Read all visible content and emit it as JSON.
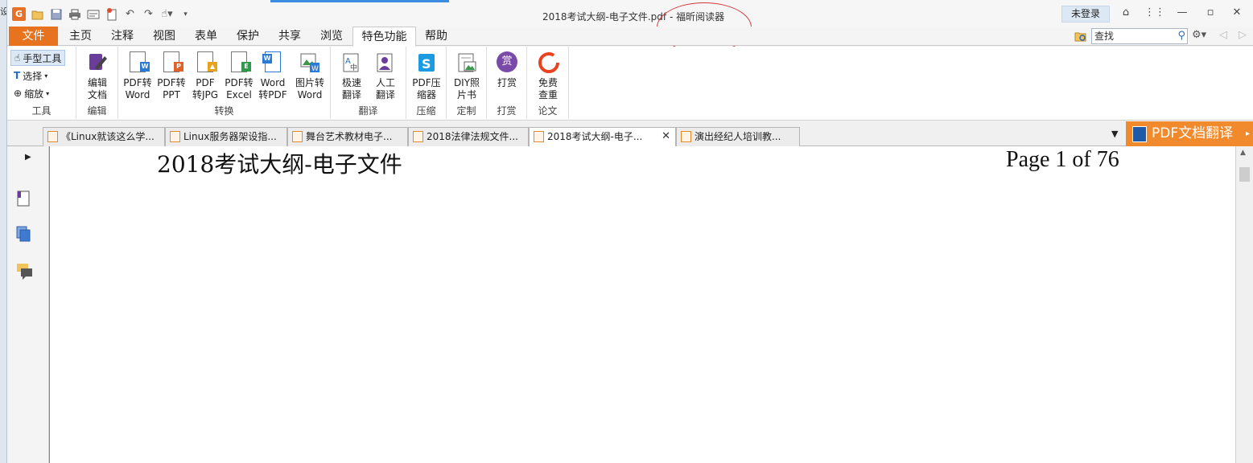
{
  "titlebar": {
    "title_doc": "2018考试大纲-电子文件.pdf - ",
    "title_app": "福昕阅读器",
    "login_label": "未登录"
  },
  "menu": {
    "tabs": [
      "文件",
      "主页",
      "注释",
      "视图",
      "表单",
      "保护",
      "共享",
      "浏览",
      "特色功能",
      "帮助"
    ],
    "search_placeholder": "查找"
  },
  "ribbon": {
    "tools": {
      "hand": "手型工具",
      "select": "选择",
      "zoom": "缩放",
      "group": "工具"
    },
    "edit": {
      "label_line1": "编辑",
      "label_line2": "文档",
      "group": "编辑"
    },
    "convert": {
      "buttons": [
        {
          "l1": "PDF转",
          "l2": "Word"
        },
        {
          "l1": "PDF转",
          "l2": "PPT"
        },
        {
          "l1": "PDF",
          "l2": "转JPG"
        },
        {
          "l1": "PDF转",
          "l2": "Excel"
        },
        {
          "l1": "Word",
          "l2": "转PDF"
        },
        {
          "l1": "图片转",
          "l2": "Word"
        }
      ],
      "group": "转换"
    },
    "translate": {
      "buttons": [
        {
          "l1": "极速",
          "l2": "翻译"
        },
        {
          "l1": "人工",
          "l2": "翻译"
        }
      ],
      "group": "翻译"
    },
    "compress": {
      "l1": "PDF压",
      "l2": "缩器",
      "group": "压缩"
    },
    "custom": {
      "l1": "DIY照",
      "l2": "片书",
      "group": "定制"
    },
    "reward": {
      "l1": "打赏",
      "icon_text": "赏",
      "group": "打赏"
    },
    "thesis": {
      "l1": "免费",
      "l2": "查重",
      "group": "论文"
    }
  },
  "doc_tabs": [
    "《Linux就该这么学...",
    "Linux服务器架设指...",
    "舞台艺术教材电子...",
    "2018法律法规文件...",
    "2018考试大纲-电子...",
    "演出经纪人培训教..."
  ],
  "translate_banner": "PDF文档翻译",
  "document": {
    "header_title": "2018考试大纲-电子文件",
    "page_indicator": "Page 1 of 76"
  },
  "colors": {
    "file_tab": "#e8731e",
    "annotation_ellipse": "#d43a3a",
    "translate_banner": "#f08a2c"
  }
}
